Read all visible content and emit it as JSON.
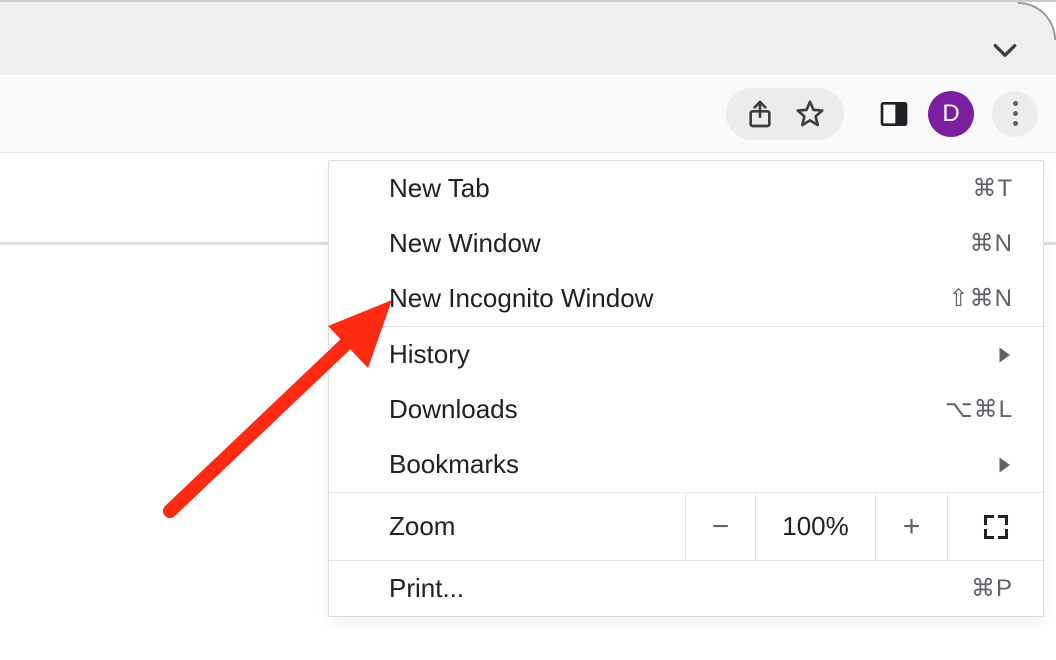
{
  "toolbar": {
    "avatar_letter": "D"
  },
  "menu": {
    "section1": [
      {
        "label": "New Tab",
        "shortcut": "⌘T"
      },
      {
        "label": "New Window",
        "shortcut": "⌘N"
      },
      {
        "label": "New Incognito Window",
        "shortcut": "⇧⌘N"
      }
    ],
    "section2": [
      {
        "label": "History",
        "submenu": true
      },
      {
        "label": "Downloads",
        "shortcut": "⌥⌘L"
      },
      {
        "label": "Bookmarks",
        "submenu": true
      }
    ],
    "zoom": {
      "label": "Zoom",
      "minus": "−",
      "value": "100%",
      "plus": "+"
    },
    "section4": [
      {
        "label": "Print...",
        "shortcut": "⌘P"
      }
    ]
  }
}
